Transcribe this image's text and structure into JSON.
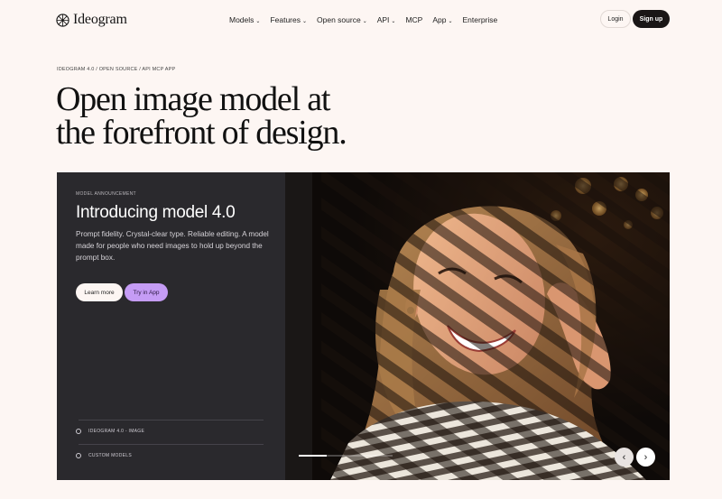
{
  "nav": {
    "logo_text": "Ideogram",
    "items": [
      {
        "label": "Models",
        "has_dropdown": true
      },
      {
        "label": "Features",
        "has_dropdown": true
      },
      {
        "label": "Open source",
        "has_dropdown": true
      },
      {
        "label": "API",
        "has_dropdown": true
      },
      {
        "label": "MCP",
        "has_dropdown": false
      },
      {
        "label": "App",
        "has_dropdown": true
      },
      {
        "label": "Enterprise",
        "has_dropdown": false
      }
    ],
    "login_label": "Login",
    "signup_label": "Sign up"
  },
  "breadcrumb": "IDEOGRAM 4.0 / OPEN SOURCE / API MCP APP",
  "headline": {
    "line1": "Open image model at",
    "line2": "the forefront of design."
  },
  "hero": {
    "label": "MODEL ANNOUNCEMENT",
    "title": "Introducing model 4.0",
    "description": "Prompt fidelity. Crystal-clear type. Reliable editing. A model made for people who need images to hold up beyond the prompt box.",
    "learn_more_label": "Learn more",
    "try_label": "Try in App",
    "list": [
      {
        "label": "IDEOGRAM 4.0 - IMAGE"
      },
      {
        "label": "CUSTOM MODELS"
      }
    ],
    "progress": 0.3
  },
  "colors": {
    "background": "#fdf6f3",
    "panel": "#2a292d",
    "accent_purple": "#c59cf5",
    "dark_button": "#1a1616"
  }
}
